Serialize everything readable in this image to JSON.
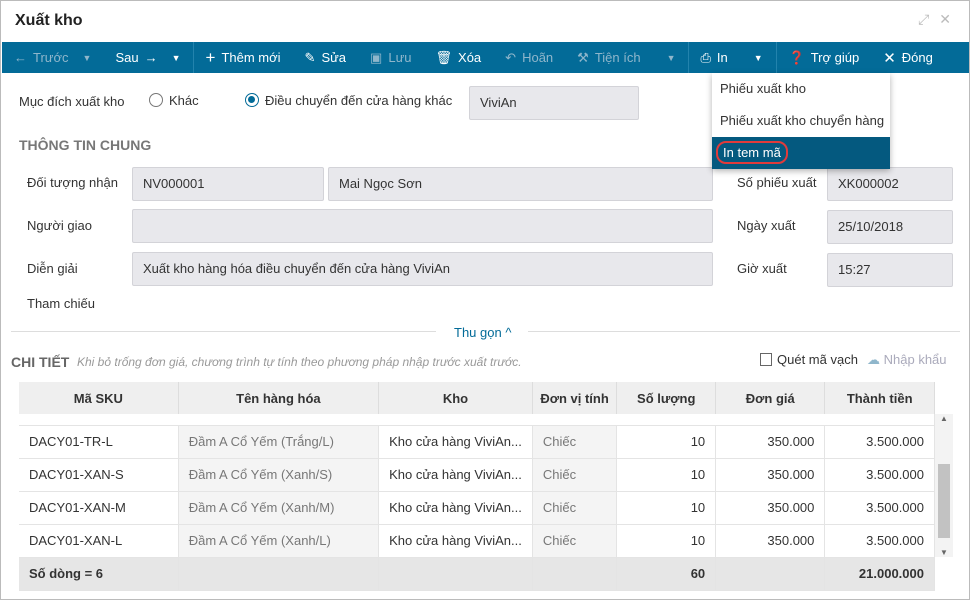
{
  "window": {
    "title": "Xuất kho"
  },
  "toolbar": {
    "prev": "Trước",
    "next": "Sau",
    "add": "Thêm mới",
    "edit": "Sửa",
    "save": "Lưu",
    "delete": "Xóa",
    "undo": "Hoãn",
    "utilities": "Tiện ích",
    "print": "In",
    "help": "Trợ giúp",
    "close": "Đóng"
  },
  "print_menu": [
    "Phiếu xuất kho",
    "Phiếu xuất kho chuyển hàng",
    "In tem mã"
  ],
  "purpose": {
    "label": "Mục đích xuất kho",
    "opt1": "Khác",
    "opt2": "Điều chuyển đến cửa hàng khác",
    "store": "ViviAn"
  },
  "general": {
    "title": "THÔNG TIN CHUNG",
    "recipient_label": "Đối tượng nhận",
    "recipient_code": "NV000001",
    "recipient_name": "Mai Ngọc Sơn",
    "deliverer_label": "Người giao",
    "deliverer": "",
    "desc_label": "Diễn giải",
    "desc": "Xuất kho hàng hóa điều chuyển đến cửa hàng ViviAn",
    "ref_label": "Tham chiếu",
    "no_label": "Số phiếu xuất",
    "no": "XK000002",
    "date_label": "Ngày xuất",
    "date": "25/10/2018",
    "time_label": "Giờ xuất",
    "time": "15:27"
  },
  "collapse": "Thu gọn",
  "detail": {
    "title": "CHI TIẾT",
    "hint": "Khi bỏ trống đơn giá, chương trình tự tính theo phương pháp nhập trước xuất trước.",
    "scan": "Quét mã vạch",
    "import": "Nhập khẩu"
  },
  "table": {
    "headers": [
      "Mã SKU",
      "Tên hàng hóa",
      "Kho",
      "Đơn vị tính",
      "Số lượng",
      "Đơn giá",
      "Thành tiền"
    ],
    "rows": [
      [
        "DACY01-TR-L",
        "Đầm A Cổ Yếm (Trắng/L)",
        "Kho cửa hàng ViviAn...",
        "Chiếc",
        "10",
        "350.000",
        "3.500.000"
      ],
      [
        "DACY01-XAN-S",
        "Đầm A Cổ Yếm (Xanh/S)",
        "Kho cửa hàng ViviAn...",
        "Chiếc",
        "10",
        "350.000",
        "3.500.000"
      ],
      [
        "DACY01-XAN-M",
        "Đầm A Cổ Yếm (Xanh/M)",
        "Kho cửa hàng ViviAn...",
        "Chiếc",
        "10",
        "350.000",
        "3.500.000"
      ],
      [
        "DACY01-XAN-L",
        "Đầm A Cổ Yếm (Xanh/L)",
        "Kho cửa hàng ViviAn...",
        "Chiếc",
        "10",
        "350.000",
        "3.500.000"
      ]
    ],
    "footer": {
      "count": "Số dòng = 6",
      "qty": "60",
      "total": "21.000.000"
    }
  }
}
